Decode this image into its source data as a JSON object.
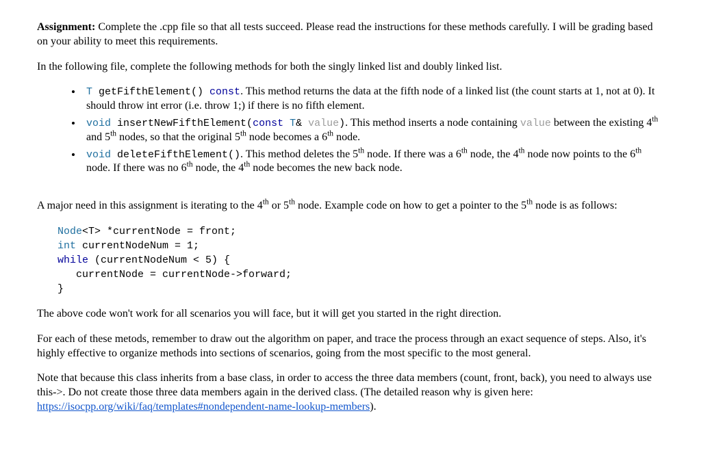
{
  "heading_label": "Assignment:",
  "intro_rest": " Complete the .cpp file so that all tests succeed. Please read the instructions for these methods carefully.  I will be grading based on your ability to meet this requirements.",
  "para2": "In the following file, complete the following methods for both the singly linked list and doubly linked list.",
  "bullets": [
    {
      "sig_type": "T ",
      "sig_name": "getFifthElement() ",
      "sig_kw": "const",
      "after_sig": ".  This method returns the data at the fifth node of a linked list (the count starts at 1, not at 0).  It should throw int error (i.e. throw 1;) if there is no fifth element."
    },
    {
      "sig_type": "void ",
      "sig_name": "insertNewFifthElement(",
      "sig_kw": "const",
      "sig_mid": " T",
      "sig_tail": "& ",
      "sig_param": "value",
      "sig_close": ")",
      "after_sig_a": ".  This method inserts a node containing ",
      "after_sig_code": "value",
      "after_sig_b1": " between the existing 4",
      "after_sig_b2": " and 5",
      "after_sig_b3": " nodes, so that the original 5",
      "after_sig_b4": " node becomes a 6",
      "after_sig_b5": " node."
    },
    {
      "sig_type": "void ",
      "sig_name": "deleteFifthElement()",
      "after_sig_a": ".  This method deletes the 5",
      "after_sig_b": " node.  If there was a 6",
      "after_sig_c": " node, the 4",
      "after_sig_d": " node now points to the 6",
      "after_sig_e": " node.  If there was no 6",
      "after_sig_f": " node, the 4",
      "after_sig_g": " node becomes the new back node."
    }
  ],
  "sup_th": "th",
  "para_major_a": "A major need in this assignment is iterating to the 4",
  "para_major_b": " or 5",
  "para_major_c": " node.  Example code on how to get a pointer to the 5",
  "para_major_d": " node is as follows:",
  "code": {
    "l1_a": "Node",
    "l1_b": "<T>",
    "l1_c": " *currentNode = front;",
    "l2_a": "int",
    "l2_b": " currentNodeNum = 1;",
    "l3_a": "while",
    "l3_b": " (currentNodeNum < 5) {",
    "l4": "   currentNode = currentNode->forward;",
    "l5": "}"
  },
  "para_after_code": "The above code won't work for all scenarios you will face, but it will get you started in the right direction.",
  "para_draw": "For each of these metods, remember to draw out the algorithm on paper, and trace the process through an exact sequence of steps.  Also, it's highly effective to organize methods into sections of scenarios, going from the most specific to the most general.",
  "para_note_a": "Note that because this class inherits from a base class, in order to access the three data members (count, front, back), you need to always use this->.  Do not create those three data members again in the derived class.  (The detailed reason why is given here: ",
  "para_note_link": "https://isocpp.org/wiki/faq/templates#nondependent-name-lookup-members",
  "para_note_b": ")."
}
